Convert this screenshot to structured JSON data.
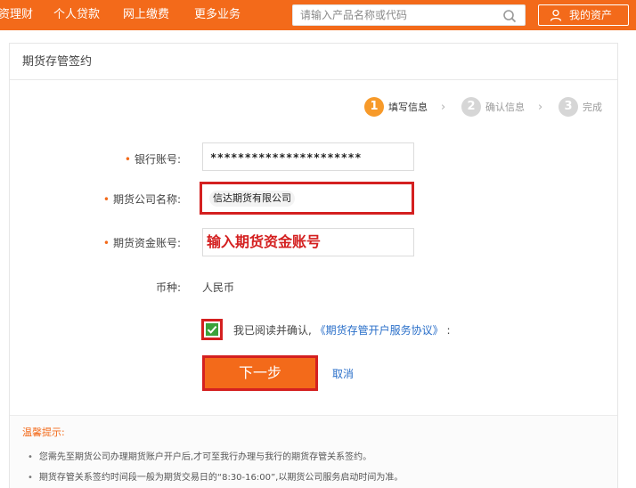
{
  "nav": {
    "items": [
      {
        "label": "资理财"
      },
      {
        "label": "个人贷款"
      },
      {
        "label": "网上缴费"
      },
      {
        "label": "更多业务"
      }
    ],
    "search_placeholder": "请输入产品名称或代码",
    "my_assets": "我的资产"
  },
  "panel": {
    "title": "期货存管签约"
  },
  "steps": [
    {
      "number": "1",
      "label": "填写信息"
    },
    {
      "number": "2",
      "label": "确认信息"
    },
    {
      "number": "3",
      "label": "完成"
    }
  ],
  "form": {
    "required_mark": "•",
    "bank_account": {
      "label": "银行账号:",
      "value": "**********************"
    },
    "company_name": {
      "label": "期货公司名称:",
      "value": "信达期货有限公司"
    },
    "fund_account": {
      "label": "期货资金账号:",
      "value": "输入期货资金账号"
    },
    "currency": {
      "label": "币种:",
      "value": "人民币"
    },
    "agree_text": "我已阅读并确认,",
    "agree_link": "《期货存管开户服务协议》",
    "agree_suffix": ":",
    "checkbox_checked": true,
    "next_button": "下一步",
    "cancel_link": "取消"
  },
  "tips": {
    "title": "温馨提示:",
    "items": [
      "您需先至期货公司办理期货账户开户后,才可至我行办理与我行的期货存管关系签约。",
      "期货存管关系签约时间段一般为期货交易日的“8:30-16:00”,以期货公司服务启动时间为准。"
    ]
  },
  "colors": {
    "brand_orange": "#f36a1a",
    "highlight_red": "#d42020",
    "link_blue": "#2a6fc9",
    "check_green": "#3aa23a"
  }
}
